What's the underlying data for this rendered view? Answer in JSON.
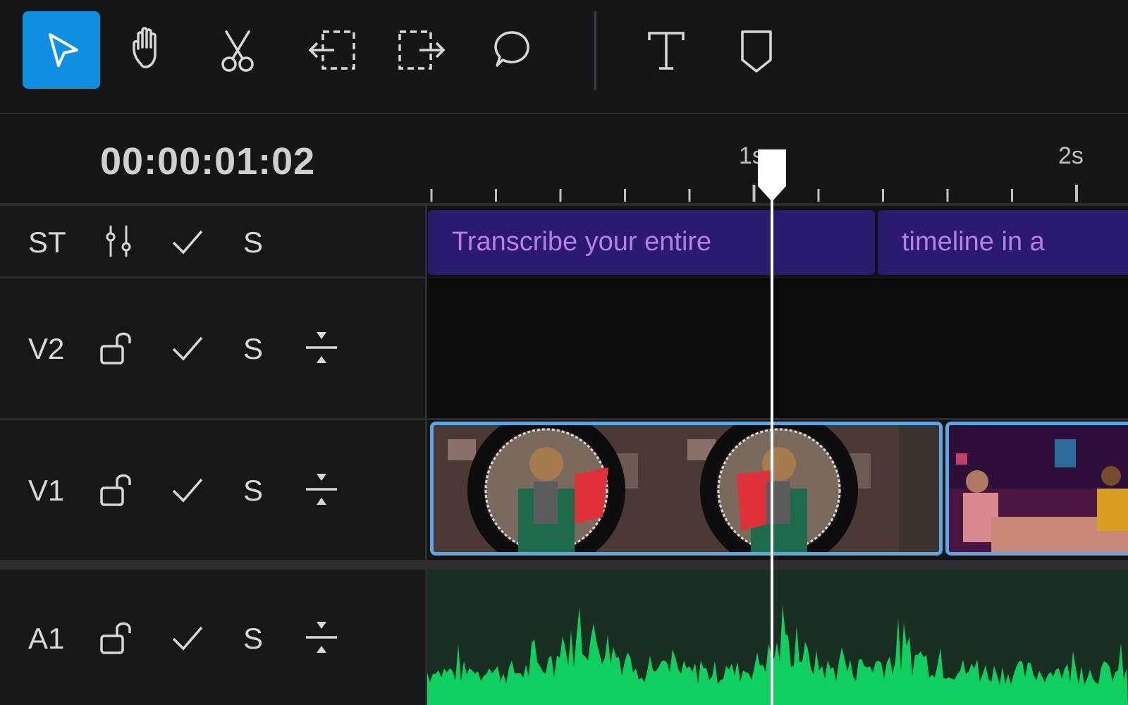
{
  "toolbar": {
    "tools": [
      {
        "name": "select-tool",
        "icon": "pointer-arrow-icon",
        "active": true
      },
      {
        "name": "hand-tool",
        "icon": "hand-icon",
        "active": false
      },
      {
        "name": "razor-tool",
        "icon": "scissors-icon",
        "active": false
      },
      {
        "name": "trim-start-tool",
        "icon": "trim-left-icon",
        "active": false
      },
      {
        "name": "trim-end-tool",
        "icon": "trim-right-icon",
        "active": false
      },
      {
        "name": "comment-tool",
        "icon": "speech-bubble-icon",
        "active": false
      },
      {
        "name": "text-tool",
        "icon": "text-T-icon",
        "active": false
      },
      {
        "name": "marker-tool",
        "icon": "marker-shield-icon",
        "active": false
      }
    ],
    "active_color": "#0f8fdf"
  },
  "timeline": {
    "timecode": "00:00:01:02",
    "ruler_labels": [
      "1s",
      "2s"
    ]
  },
  "tracks": {
    "st": {
      "label": "ST",
      "icons": [
        "sliders-icon",
        "check-icon"
      ],
      "solo": "S"
    },
    "v2": {
      "label": "V2",
      "icons": [
        "unlock-icon",
        "check-icon",
        "collapse-icon"
      ],
      "solo": "S"
    },
    "v1": {
      "label": "V1",
      "icons": [
        "unlock-icon",
        "check-icon",
        "collapse-icon"
      ],
      "solo": "S"
    },
    "a1": {
      "label": "A1",
      "icons": [
        "unlock-icon",
        "check-icon",
        "collapse-icon"
      ],
      "solo": "S"
    }
  },
  "subtitles": [
    {
      "text": "Transcribe your entire"
    },
    {
      "text": "timeline in a"
    }
  ],
  "colors": {
    "subtitle_clip": "#2c1a6e",
    "subtitle_text": "#b37fe8",
    "video_clip_border": "#5aa7e6",
    "audio_lane": "#1a2e22",
    "audio_wave": "#0fcf5f",
    "playhead": "#ffffff"
  }
}
